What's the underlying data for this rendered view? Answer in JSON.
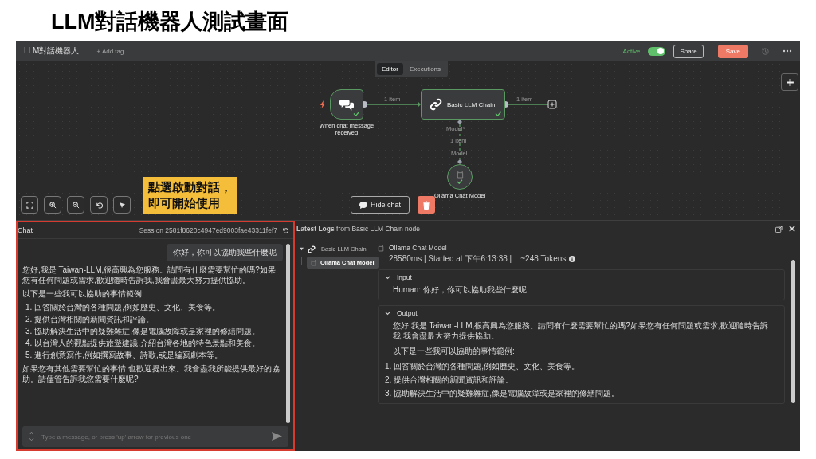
{
  "slide_title": "LLM對話機器人測試畫面",
  "topbar": {
    "workflow_name": "LLM對話機器人",
    "add_tag": "+ Add tag",
    "active_label": "Active",
    "active": true,
    "share": "Share",
    "save": "Save"
  },
  "view_tabs": [
    {
      "label": "Editor",
      "selected": true
    },
    {
      "label": "Executions",
      "selected": false
    }
  ],
  "nodes": [
    {
      "kind": "trigger",
      "label": "When chat message received",
      "done": true
    },
    {
      "kind": "chain",
      "label": "Basic LLM Chain",
      "done": true
    },
    {
      "kind": "model",
      "label": "Ollama Chat Model",
      "done": true
    }
  ],
  "connections": [
    {
      "kind": "main",
      "label": "1 item"
    },
    {
      "kind": "output",
      "label": "1 item"
    },
    {
      "kind": "model",
      "label": "1 item",
      "source_label": "Model*",
      "target_label": "Model"
    }
  ],
  "callout": {
    "lines": [
      "點選啟動對話，",
      "即可開始使用"
    ]
  },
  "hide_chat": "Hide chat",
  "chat": {
    "title": "Chat",
    "session": "Session  2581f8620c4947ed9003fae43311fef7",
    "messages": [
      {
        "kind": "user",
        "text": "你好，你可以協助我些什麼呢"
      },
      {
        "kind": "bot",
        "blocks": [
          {
            "kind": "paragraph",
            "text": "您好,我是 Taiwan-LLM,很高興為您服務。請問有什麼需要幫忙的嗎?如果您有任何問題或需求,歡迎隨時告訴我,我會盡最大努力提供協助。"
          },
          {
            "kind": "paragraph",
            "text": "以下是一些我可以協助的事情範例:"
          },
          {
            "kind": "list",
            "items": [
              {
                "number": "1.",
                "text": "回答關於台灣的各種問題,例如歷史、文化、美食等。"
              },
              {
                "number": "2.",
                "text": "提供台灣相關的新聞資訊和評論。"
              },
              {
                "number": "3.",
                "text": "協助解決生活中的疑難雜症,像是電腦故障或是家裡的修繕問題。"
              },
              {
                "number": "4.",
                "text": "以台灣人的觀點提供旅遊建議,介紹台灣各地的特色景點和美食。"
              },
              {
                "number": "5.",
                "text": "進行創意寫作,例如撰寫故事、詩歌,或是編寫劇本等。"
              }
            ]
          },
          {
            "kind": "paragraph",
            "text": "如果您有其他需要幫忙的事情,也歡迎提出來。我會盡我所能提供最好的協助。請儘管告訴我您需要什麼呢?"
          }
        ]
      }
    ],
    "input_placeholder": "Type a message, or press 'up' arrow for previous one"
  },
  "logs": {
    "title": "**Latest Logs** from Basic LLM Chain node",
    "tree": [
      {
        "label": "Basic LLM Chain",
        "kind": "chain",
        "expanded": true,
        "selected": false,
        "children": [
          {
            "label": "Ollama Chat Model",
            "kind": "model",
            "selected": true
          }
        ]
      }
    ],
    "detail": {
      "title": "Ollama Chat Model",
      "meta": "28580ms | Started at 下午6:13:38 |    ~248 Tokens",
      "sections": [
        {
          "title": "Input",
          "expanded": true,
          "blocks": [
            {
              "kind": "paragraph",
              "text": "Human: 你好，你可以協助我些什麼呢"
            }
          ]
        },
        {
          "title": "Output",
          "expanded": true,
          "blocks": [
            {
              "kind": "paragraph",
              "text": "您好,我是 Taiwan-LLM,很高興為您服務。請問有什麼需要幫忙的嗎?如果您有任何問題或需求,歡迎隨時告訴我,我會盡最大努力提供協助。"
            },
            {
              "kind": "paragraph",
              "text": "以下是一些我可以協助的事情範例:"
            },
            {
              "kind": "list",
              "items": [
                {
                  "number": "1.",
                  "text": "回答關於台灣的各種問題,例如歷史、文化、美食等。"
                },
                {
                  "number": "2.",
                  "text": "提供台灣相關的新聞資訊和評論。"
                },
                {
                  "number": "3.",
                  "text": "協助解決生活中的疑難雜症,像是電腦故障或是家裡的修繕問題。"
                }
              ]
            }
          ]
        }
      ]
    }
  }
}
